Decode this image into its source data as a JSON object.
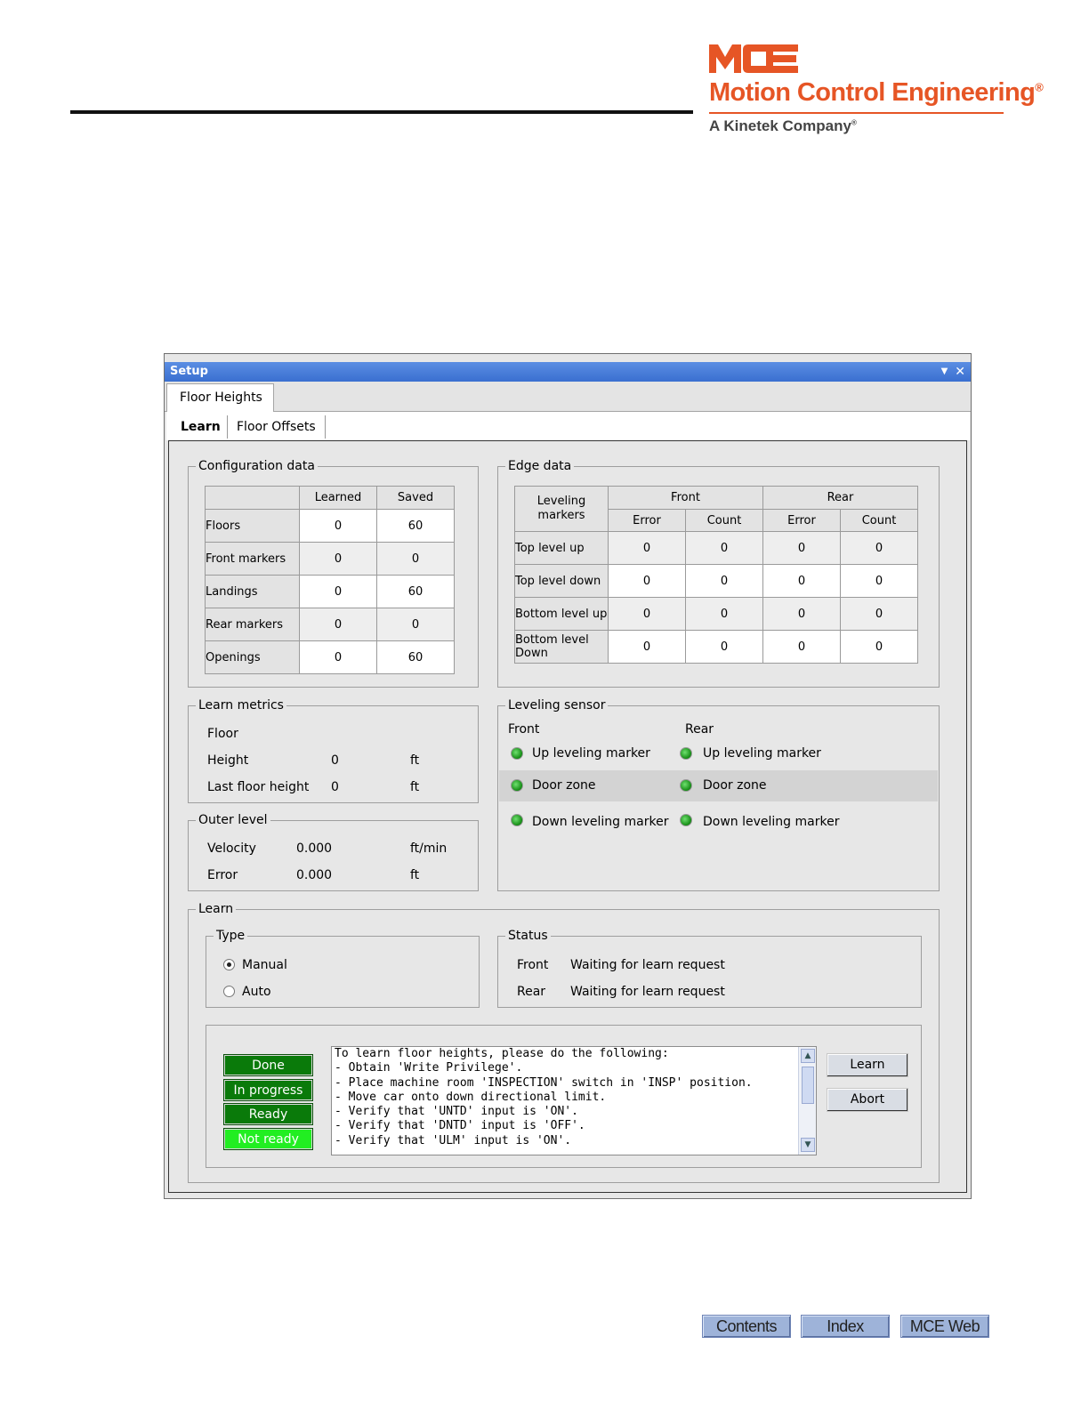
{
  "brand": {
    "logo_letters": "MCE",
    "name": "Motion Control Engineering",
    "registered": "®",
    "tagline": "A Kinetek Company",
    "tagline_mark": "®",
    "brand_color": "#e65525"
  },
  "window": {
    "title": "Setup",
    "menu_icon": "▼",
    "close_icon": "✕",
    "tabs_main": [
      "Floor Heights"
    ],
    "tabs_sub": [
      "Learn",
      "Floor Offsets"
    ]
  },
  "config": {
    "title": "Configuration data",
    "headers": [
      "Learned",
      "Saved"
    ],
    "rows": [
      {
        "label": "Floors",
        "learned": "0",
        "saved": "60"
      },
      {
        "label": "Front markers",
        "learned": "0",
        "saved": "0"
      },
      {
        "label": "Landings",
        "learned": "0",
        "saved": "60"
      },
      {
        "label": "Rear markers",
        "learned": "0",
        "saved": "0"
      },
      {
        "label": "Openings",
        "learned": "0",
        "saved": "60"
      }
    ]
  },
  "edge": {
    "title": "Edge data",
    "corner": "Leveling markers",
    "groups": [
      "Front",
      "Rear"
    ],
    "sub": [
      "Error",
      "Count",
      "Error",
      "Count"
    ],
    "rows": [
      {
        "label": "Top level up",
        "values": [
          "0",
          "0",
          "0",
          "0"
        ]
      },
      {
        "label": "Top level down",
        "values": [
          "0",
          "0",
          "0",
          "0"
        ]
      },
      {
        "label": "Bottom level up",
        "values": [
          "0",
          "0",
          "0",
          "0"
        ]
      },
      {
        "label": "Bottom level Down",
        "values": [
          "0",
          "0",
          "0",
          "0"
        ]
      }
    ]
  },
  "metrics": {
    "title": "Learn metrics",
    "floor_label": "Floor",
    "height_label": "Height",
    "height_value": "0",
    "height_unit": "ft",
    "last_label": "Last floor height",
    "last_value": "0",
    "last_unit": "ft"
  },
  "outer": {
    "title": "Outer level",
    "velocity_label": "Velocity",
    "velocity_value": "0.000",
    "velocity_unit": "ft/min",
    "error_label": "Error",
    "error_value": "0.000",
    "error_unit": "ft"
  },
  "sensor": {
    "title": "Leveling sensor",
    "front": "Front",
    "rear": "Rear",
    "items": [
      "Up leveling marker",
      "Door zone",
      "Down leveling marker"
    ]
  },
  "learn": {
    "title": "Learn",
    "type_title": "Type",
    "manual": "Manual",
    "auto": "Auto",
    "status_title": "Status",
    "front_label": "Front",
    "front_status": "Waiting for learn request",
    "rear_label": "Rear",
    "rear_status": "Waiting for learn request",
    "indicators": [
      "Done",
      "In progress",
      "Ready",
      "Not ready"
    ],
    "messages": [
      "To learn floor heights, please do the following:",
      "- Obtain 'Write Privilege'.",
      "- Place machine room 'INSPECTION' switch in 'INSP' position.",
      "- Move car onto down directional limit.",
      "- Verify that 'UNTD' input is 'ON'.",
      "- Verify that 'DNTD' input is 'OFF'.",
      "- Verify that 'ULM' input is 'ON'."
    ],
    "scroll_up": "▲",
    "scroll_down": "▼",
    "learn_button": "Learn",
    "abort_button": "Abort"
  },
  "nav": {
    "contents": "Contents",
    "index": "Index",
    "web": "MCE Web"
  }
}
